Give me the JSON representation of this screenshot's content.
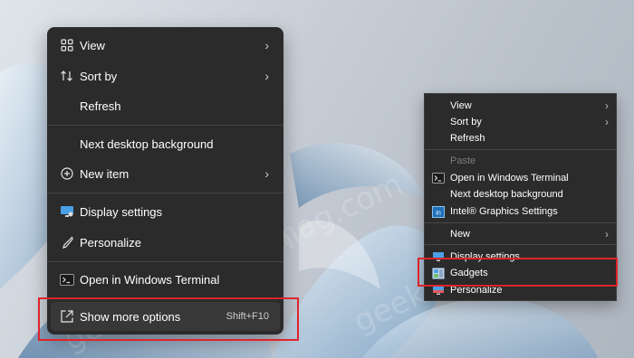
{
  "watermark": {
    "text_a": "geekermag.com",
    "text_b": "geekermag.com",
    "text_c": "geekermag.com"
  },
  "menu_win11": {
    "items": [
      {
        "label": "View",
        "icon": "grid-icon",
        "submenu": true
      },
      {
        "label": "Sort by",
        "icon": "sort-icon",
        "submenu": true
      },
      {
        "label": "Refresh"
      },
      {
        "label": "Next desktop background"
      },
      {
        "label": "New item",
        "icon": "plus-circle-icon",
        "submenu": true
      },
      {
        "label": "Display settings",
        "icon": "display-icon"
      },
      {
        "label": "Personalize",
        "icon": "brush-icon"
      },
      {
        "label": "Open in Windows Terminal",
        "icon": "terminal-icon"
      },
      {
        "label": "Show more options",
        "icon": "expand-icon",
        "shortcut": "Shift+F10",
        "highlighted": true
      }
    ],
    "chevron": "›"
  },
  "menu_classic": {
    "items": [
      {
        "label": "View",
        "submenu": true
      },
      {
        "label": "Sort by",
        "submenu": true
      },
      {
        "label": "Refresh"
      },
      {
        "label": "Paste",
        "disabled": true
      },
      {
        "label": "Open in Windows Terminal",
        "icon": "terminal-icon"
      },
      {
        "label": "Next desktop background"
      },
      {
        "label": "Intel® Graphics Settings",
        "icon": "intel-graphics-icon"
      },
      {
        "label": "New",
        "submenu": true
      },
      {
        "label": "Display settings",
        "icon": "display-icon"
      },
      {
        "label": "Gadgets",
        "icon": "gadgets-icon"
      },
      {
        "label": "Personalize",
        "icon": "personalize-icon"
      }
    ],
    "chevron": "›"
  },
  "colors": {
    "menu_bg": "#2b2b2b",
    "highlight_red": "#e0232b",
    "accent_blue": "#4aa0e6"
  }
}
